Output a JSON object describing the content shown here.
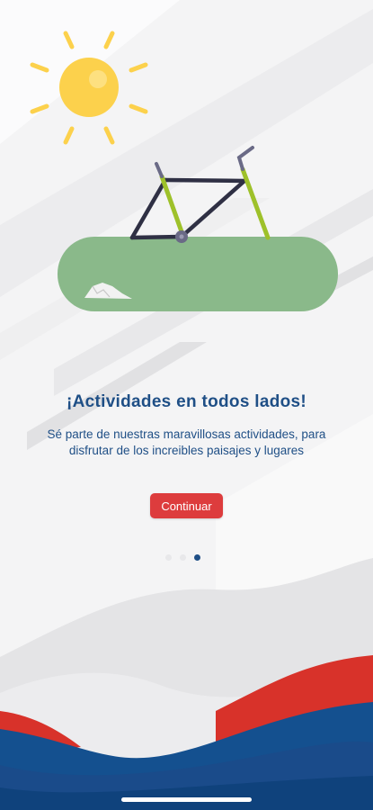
{
  "onboarding": {
    "headline": "¡Actividades en todos lados!",
    "description": "Sé parte de nuestras maravillosas actividades, para disfrutar de los increibles paisajes y lugares",
    "continue_label": "Continuar",
    "pages": [
      {
        "active": false
      },
      {
        "active": false
      },
      {
        "active": true
      }
    ]
  },
  "colors": {
    "background": "#f4f4f5",
    "headline": "#1f4f86",
    "description": "#1f4f86",
    "button_bg": "#dd3c3d",
    "button_text": "#ffffff",
    "dot_active": "#1f4f86",
    "dot_inactive": "#e8e8ea",
    "sun": "#fcd14c",
    "grass": "#8ab98a",
    "bike_frame": "#2f3044",
    "bike_fork": "#9ec12a",
    "wave_red": "#d8322a",
    "wave_blue": "#14508f",
    "home_indicator": "#ffffff"
  },
  "icons": {
    "sun": "sun-icon",
    "bike": "bike-frame-icon",
    "grass": "grass-patch",
    "rock": "rock-icon"
  }
}
